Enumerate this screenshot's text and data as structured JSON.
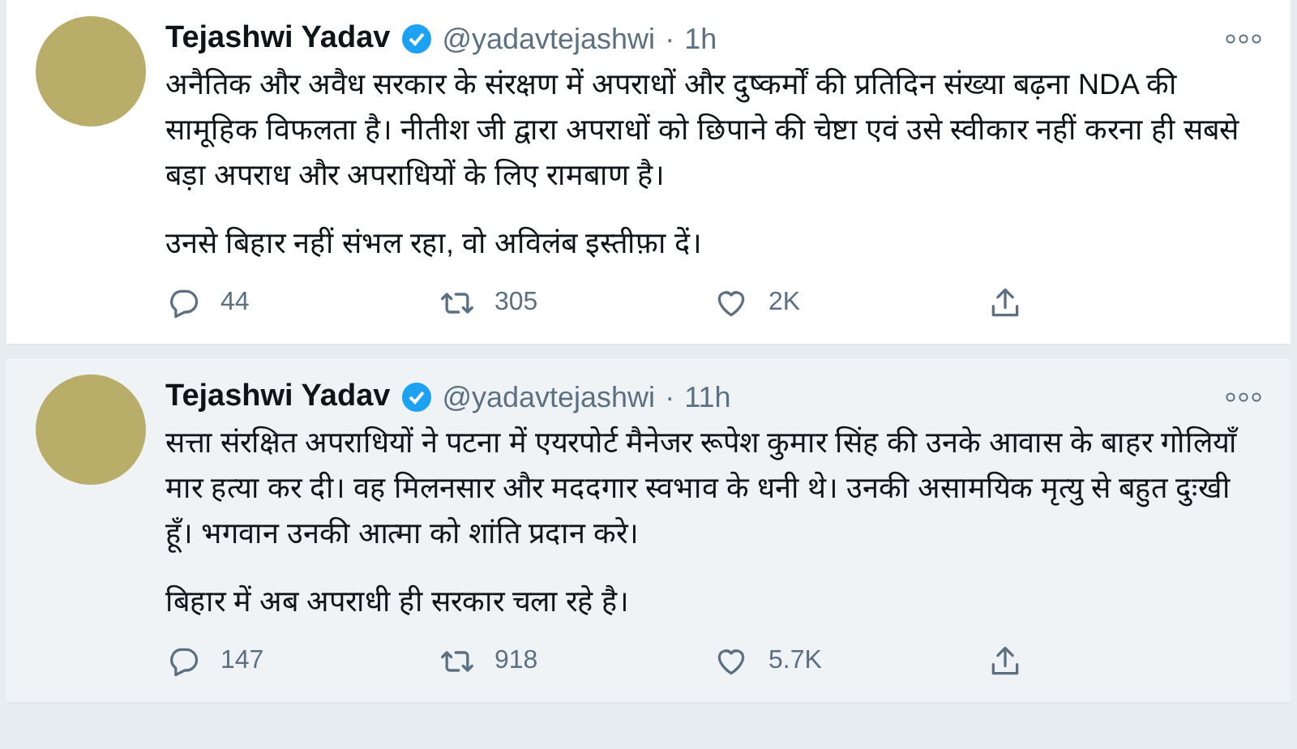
{
  "tweets": [
    {
      "highlighted": false,
      "name": "Tejashwi Yadav",
      "verified": true,
      "handle": "@yadavtejashwi",
      "separator": "·",
      "time": "1h",
      "paragraphs": [
        "अनैतिक और अवैध सरकार के संरक्षण में अपराधों और दुष्कर्मों की प्रतिदिन संख्या बढ़ना NDA की सामूहिक विफलता है। नीतीश जी द्वारा अपराधों को छिपाने की चेष्टा एवं उसे स्वीकार नहीं करना ही सबसे बड़ा अपराध और अपराधियों के लिए रामबाण है।",
        "उनसे बिहार नहीं संभल रहा, वो अविलंब इस्तीफ़ा दें।"
      ],
      "replies": "44",
      "retweets": "305",
      "likes": "2K"
    },
    {
      "highlighted": true,
      "name": "Tejashwi Yadav",
      "verified": true,
      "handle": "@yadavtejashwi",
      "separator": "·",
      "time": "11h",
      "paragraphs": [
        "सत्ता संरक्षित अपराधियों ने पटना में एयरपोर्ट मैनेजर रूपेश कुमार सिंह की उनके आवास के बाहर गोलियाँ मार हत्या कर दी। वह मिलनसार और मददगार स्वभाव के धनी थे। उनकी असामयिक मृत्यु से बहुत दुःखी हूँ। भगवान उनकी आत्मा को शांति प्रदान करे।",
        "बिहार में अब अपराधी ही सरकार चला रहे है।"
      ],
      "replies": "147",
      "retweets": "918",
      "likes": "5.7K"
    }
  ]
}
